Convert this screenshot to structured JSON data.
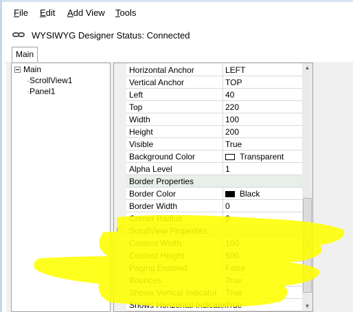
{
  "menu": {
    "file": "File",
    "edit": "Edit",
    "add_view": "Add View",
    "tools": "Tools"
  },
  "status": {
    "text": "WYSIWYG Designer Status: Connected",
    "icon": "link-icon"
  },
  "tabs": [
    {
      "label": "Main",
      "selected": true
    }
  ],
  "tree": {
    "root": "Main",
    "children": [
      "ScrollView1",
      "Panel1"
    ],
    "selected": "ScrollView1"
  },
  "properties": [
    {
      "name": "Horizontal Anchor",
      "value": "LEFT"
    },
    {
      "name": "Vertical Anchor",
      "value": "TOP"
    },
    {
      "name": "Left",
      "value": "40"
    },
    {
      "name": "Top",
      "value": "220"
    },
    {
      "name": "Width",
      "value": "100"
    },
    {
      "name": "Height",
      "value": "200"
    },
    {
      "name": "Visible",
      "value": "True"
    },
    {
      "name": "Background Color",
      "value": "Transparent",
      "swatch": "#ffffff"
    },
    {
      "name": "Alpha Level",
      "value": "1"
    },
    {
      "name": "Border Properties",
      "category": true
    },
    {
      "name": "Border Color",
      "value": "Black",
      "swatch": "#000000"
    },
    {
      "name": "Border Width",
      "value": "0"
    },
    {
      "name": "Corner Radius",
      "value": "0"
    },
    {
      "name": "ScrollView Properties",
      "category": true,
      "collapse": "⊟"
    },
    {
      "name": "Content Width",
      "value": "100"
    },
    {
      "name": "Content Height",
      "value": "500"
    },
    {
      "name": "Paging Enabled",
      "value": "False"
    },
    {
      "name": "Bounces",
      "value": "True"
    },
    {
      "name": "Shows Vertical Indicator",
      "value": "True"
    },
    {
      "name": "Shows Horizontal Indicator",
      "value": "True"
    }
  ],
  "colors": {
    "highlight": "#ffff00",
    "category_row": "#e8efe8"
  }
}
